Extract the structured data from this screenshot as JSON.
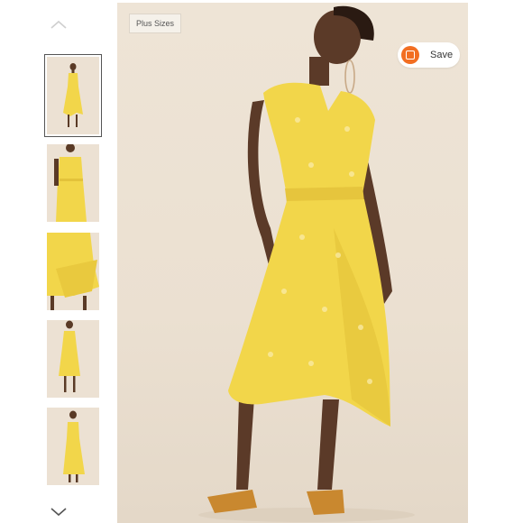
{
  "gallery": {
    "badge": "Plus Sizes",
    "save_label": "Save",
    "thumbnails": [
      {
        "view": "front-full",
        "selected": true
      },
      {
        "view": "front-waist",
        "selected": false
      },
      {
        "view": "skirt-detail",
        "selected": false
      },
      {
        "view": "front-walk",
        "selected": false
      },
      {
        "view": "side-full",
        "selected": false
      }
    ]
  },
  "colors": {
    "dress": "#f2d64a",
    "backdrop": "#ece1d3",
    "save_accent": "#f26e22"
  },
  "icons": {
    "prev": "chevron-up-icon",
    "next": "chevron-down-icon",
    "save": "save-icon"
  }
}
